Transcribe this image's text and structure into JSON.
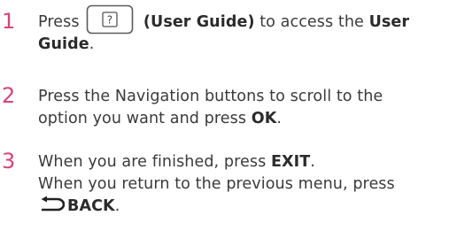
{
  "steps": [
    {
      "number": "1",
      "press": "Press",
      "guide_key_label": "(User Guide)",
      "access_text": "to access the",
      "user_word": "User",
      "guide_word": "Guide",
      "period": ".",
      "key_icon": "question-key-icon"
    },
    {
      "number": "2",
      "line1": "Press the Navigation buttons to scroll to the",
      "line2_prefix": "option you want and press",
      "ok_label": "OK",
      "period": "."
    },
    {
      "number": "3",
      "line1_prefix": "When you are finished, press",
      "exit_label": "EXIT",
      "period": ".",
      "line2": "When you return to the previous menu, press",
      "back_icon": "back-arrow-icon",
      "back_label": "BACK",
      "period2": "."
    }
  ],
  "colors": {
    "step_number": "#d4457a",
    "text": "#3a3a3a",
    "bold": "#2b2b2b"
  }
}
